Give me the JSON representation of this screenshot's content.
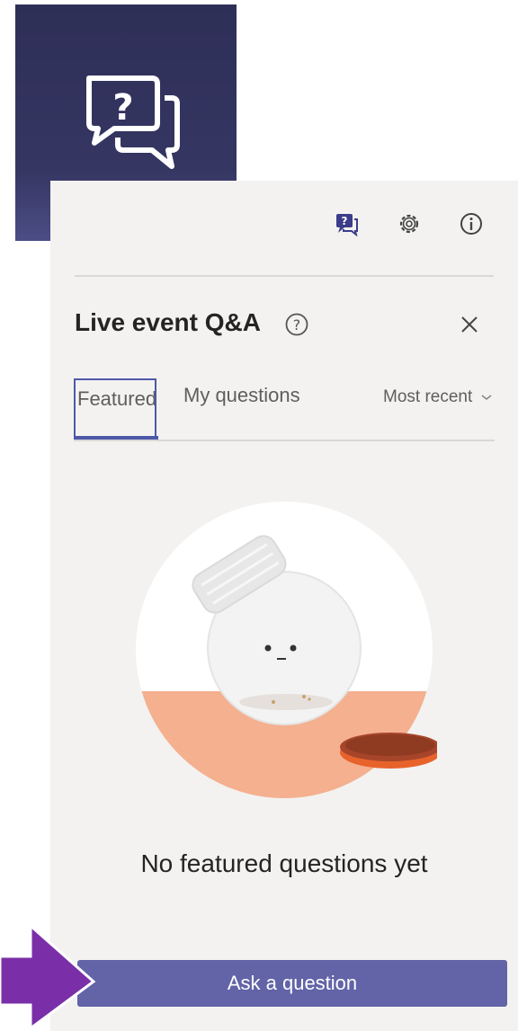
{
  "header": {
    "title": "Live event Q&A"
  },
  "tabs": [
    {
      "label": "Featured",
      "active": true
    },
    {
      "label": "My questions",
      "active": false
    }
  ],
  "sort": {
    "label": "Most recent"
  },
  "empty_state": {
    "message": "No featured questions yet"
  },
  "ask_button": {
    "label": "Ask a question"
  },
  "icons": {
    "app_tile": "qa-chat-icon",
    "toolbar": [
      "qa-icon",
      "gear-icon",
      "info-icon"
    ],
    "help": "help-icon",
    "close": "close-icon",
    "sort": "chevron-down-icon",
    "callout": "arrow-icon"
  },
  "colors": {
    "accent": "#6264a7",
    "tile_background": "#33345f",
    "panel_background": "#f3f2f1",
    "illustration_floor": "#f4b08f",
    "lid": "#e8632c"
  }
}
